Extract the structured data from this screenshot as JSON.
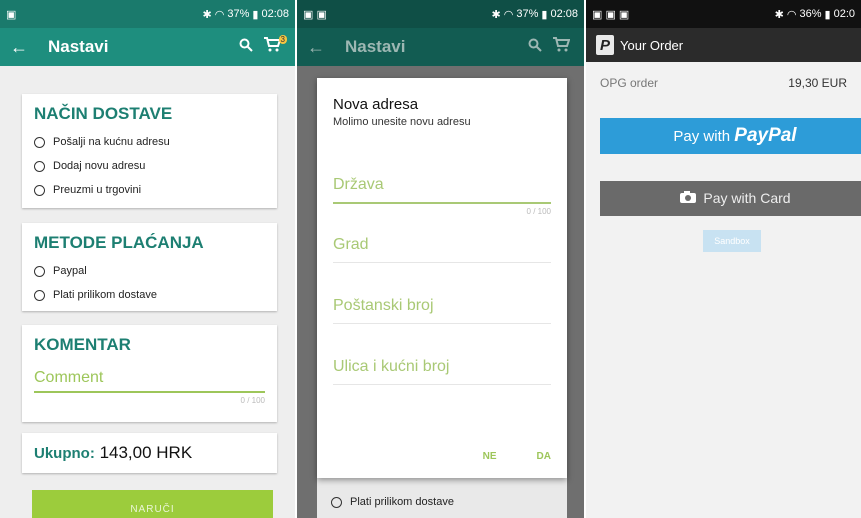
{
  "screen1": {
    "status": {
      "time": "02:08",
      "battery": "37%"
    },
    "appbar": {
      "title": "Nastavi",
      "cart_badge": "3"
    },
    "delivery": {
      "title": "NAČIN DOSTAVE",
      "options": [
        "Pošalji na kućnu adresu",
        "Dodaj novu adresu",
        "Preuzmi u trgovini"
      ]
    },
    "payment": {
      "title": "METODE PLAĆANJA",
      "options": [
        "Paypal",
        "Plati prilikom dostave"
      ]
    },
    "comment": {
      "title": "KOMENTAR",
      "placeholder": "Comment",
      "counter": "0 / 100"
    },
    "total": {
      "label": "Ukupno:",
      "value": "143,00 HRK"
    },
    "order_button": "NARUČI"
  },
  "screen2": {
    "status": {
      "time": "02:08",
      "battery": "37%"
    },
    "appbar": {
      "title": "Nastavi"
    },
    "dialog": {
      "title": "Nova adresa",
      "subtitle": "Molimo unesite novu adresu",
      "fields": [
        "Država",
        "Grad",
        "Poštanski broj",
        "Ulica i kućni broj"
      ],
      "counter": "0 / 100",
      "cancel": "NE",
      "confirm": "DA"
    },
    "behind_option": "Plati prilikom dostave"
  },
  "screen3": {
    "status": {
      "time": "02:0",
      "battery": "36%"
    },
    "header": "Your Order",
    "order": {
      "label": "OPG order",
      "amount": "19,30 EUR"
    },
    "paypal": {
      "prefix": "Pay with",
      "brand": "PayPal"
    },
    "card": "Pay with Card",
    "sandbox": "Sandbox"
  },
  "colors": {
    "teal": "#1e8e7e",
    "green": "#9dc65a",
    "paypal_blue": "#2d9cd8"
  }
}
